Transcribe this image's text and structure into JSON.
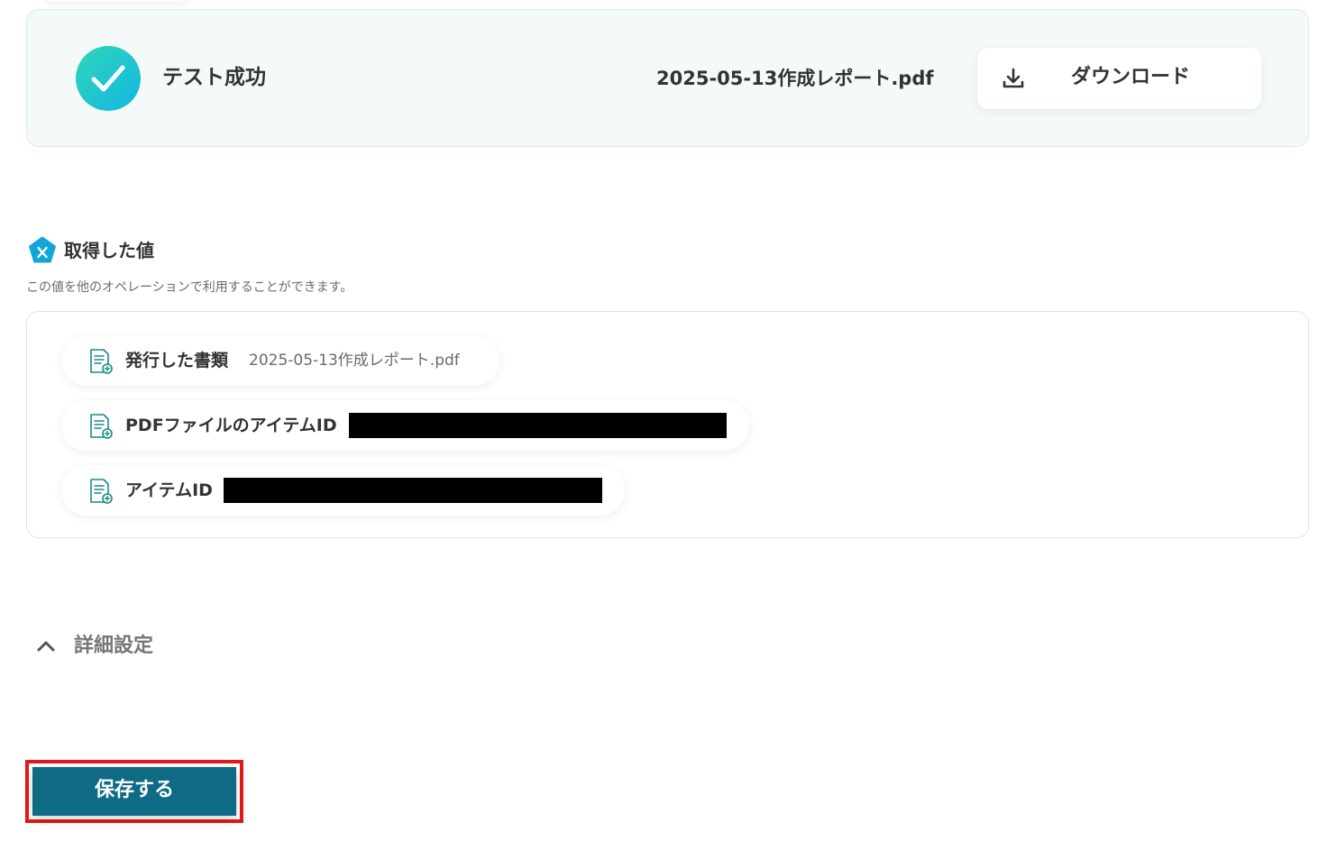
{
  "test_result": {
    "status_label": "テスト成功",
    "file_name": "2025-05-13作成レポート.pdf",
    "download_label": "ダウンロード"
  },
  "retrieved_values": {
    "heading": "取得した値",
    "description": "この値を他のオペレーションで利用することができます。",
    "items": [
      {
        "label": "発行した書類",
        "value": "2025-05-13作成レポート.pdf"
      },
      {
        "label": "PDFファイルのアイテムID",
        "value": null
      },
      {
        "label": "アイテムID",
        "value": null
      }
    ]
  },
  "advanced_settings": {
    "label": "詳細設定"
  },
  "save": {
    "label": "保存する"
  },
  "colors": {
    "success_gradient_start": "#2fd6b8",
    "success_gradient_end": "#13b7e3",
    "card_background": "#f3faf9",
    "save_button": "#0f6b84",
    "highlight_border": "#e01b1b",
    "icon_teal": "#1a8a86"
  }
}
